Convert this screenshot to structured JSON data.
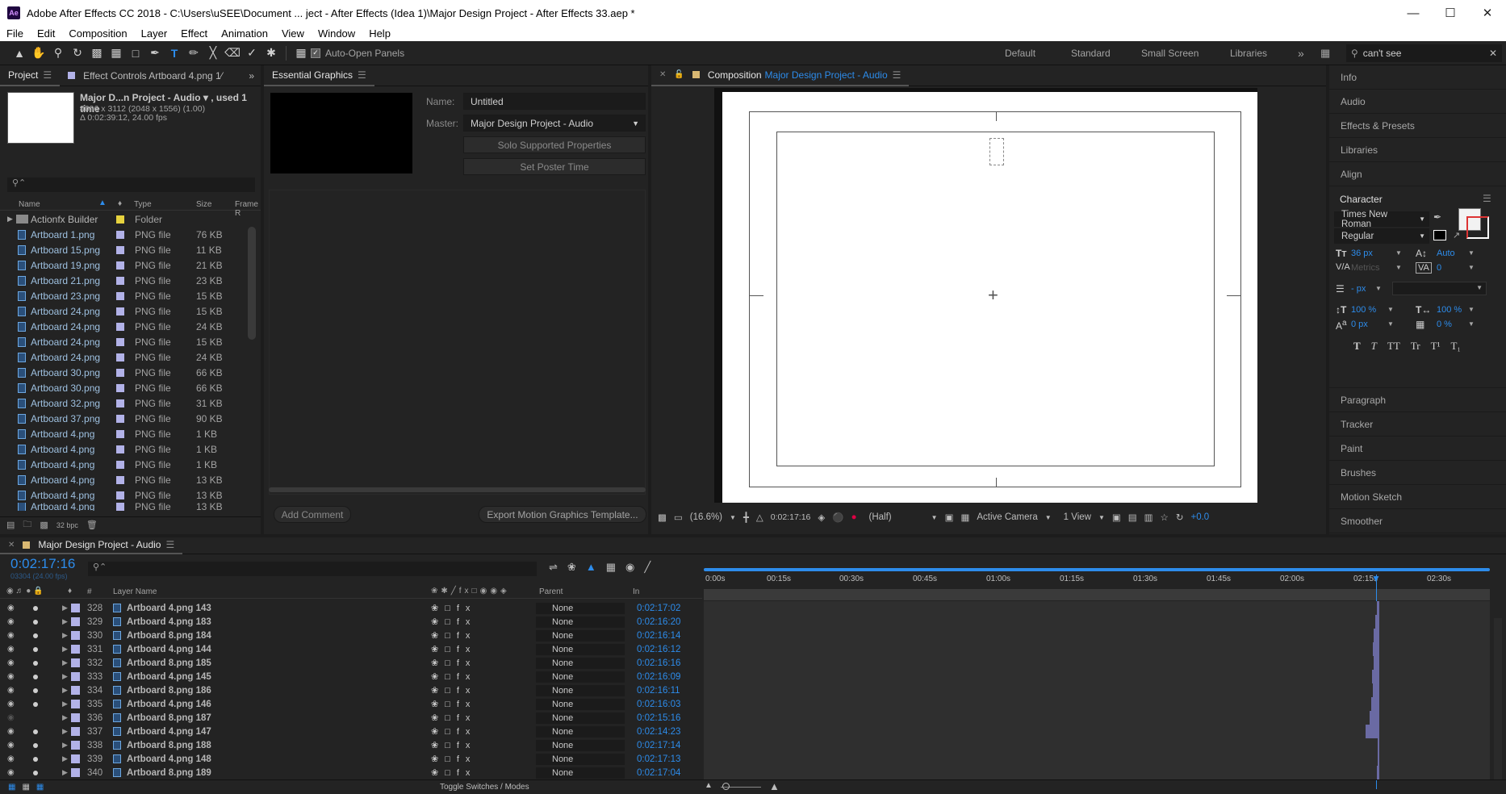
{
  "window": {
    "title": "Adobe After Effects CC 2018 - C:\\Users\\uSEE\\Document ... ject - After Effects (Idea 1)\\Major Design Project - After Effects 33.aep *",
    "app_icon": "Ae"
  },
  "menu": [
    "File",
    "Edit",
    "Composition",
    "Layer",
    "Effect",
    "Animation",
    "View",
    "Window",
    "Help"
  ],
  "toolbar": {
    "auto_open": "Auto-Open Panels",
    "workspaces": [
      "Default",
      "Standard",
      "Small Screen",
      "Libraries"
    ],
    "search": "can't see"
  },
  "project": {
    "tab1": "Project",
    "tab2": "Effect Controls Artboard 4.png 1⁄",
    "comp_name": "Major D...n Project - Audio ▾ , used 1 time",
    "comp_info1": "4096 x 3112  (2048 x 1556) (1.00)",
    "comp_info2": "Δ 0:02:39:12, 24.00 fps",
    "cols": [
      "Name",
      "Type",
      "Size",
      "Frame R"
    ],
    "items": [
      {
        "name": "Actionfx Builder",
        "type": "Folder",
        "size": ""
      },
      {
        "name": "Artboard 1.png",
        "type": "PNG file",
        "size": "76 KB"
      },
      {
        "name": "Artboard 15.png",
        "type": "PNG file",
        "size": "11 KB"
      },
      {
        "name": "Artboard 19.png",
        "type": "PNG file",
        "size": "21 KB"
      },
      {
        "name": "Artboard 21.png",
        "type": "PNG file",
        "size": "23 KB"
      },
      {
        "name": "Artboard 23.png",
        "type": "PNG file",
        "size": "15 KB"
      },
      {
        "name": "Artboard 24.png",
        "type": "PNG file",
        "size": "15 KB"
      },
      {
        "name": "Artboard 24.png",
        "type": "PNG file",
        "size": "24 KB"
      },
      {
        "name": "Artboard 24.png",
        "type": "PNG file",
        "size": "15 KB"
      },
      {
        "name": "Artboard 24.png",
        "type": "PNG file",
        "size": "24 KB"
      },
      {
        "name": "Artboard 30.png",
        "type": "PNG file",
        "size": "66 KB"
      },
      {
        "name": "Artboard 30.png",
        "type": "PNG file",
        "size": "66 KB"
      },
      {
        "name": "Artboard 32.png",
        "type": "PNG file",
        "size": "31 KB"
      },
      {
        "name": "Artboard 37.png",
        "type": "PNG file",
        "size": "90 KB"
      },
      {
        "name": "Artboard 4.png",
        "type": "PNG file",
        "size": "1 KB"
      },
      {
        "name": "Artboard 4.png",
        "type": "PNG file",
        "size": "1 KB"
      },
      {
        "name": "Artboard 4.png",
        "type": "PNG file",
        "size": "1 KB"
      },
      {
        "name": "Artboard 4.png",
        "type": "PNG file",
        "size": "13 KB"
      },
      {
        "name": "Artboard 4.png",
        "type": "PNG file",
        "size": "13 KB"
      },
      {
        "name": "Artboard 4.png",
        "type": "PNG file",
        "size": "13 KB"
      }
    ],
    "bpc": "32 bpc"
  },
  "eg": {
    "tab": "Essential Graphics",
    "name_label": "Name:",
    "name_value": "Untitled",
    "master_label": "Master:",
    "master_value": "Major Design Project - Audio",
    "solo": "Solo Supported Properties",
    "poster": "Set Poster Time",
    "add_comment": "Add Comment",
    "export": "Export Motion Graphics Template..."
  },
  "comp": {
    "tab_prefix": "Composition",
    "tab_name": "Major Design Project - Audio",
    "zoom": "(16.6%)",
    "time": "0:02:17:16",
    "res": "(Half)",
    "camera": "Active Camera",
    "view": "1 View",
    "exposure": "+0.0"
  },
  "right": {
    "items_top": [
      "Info",
      "Audio",
      "Effects & Presets",
      "Libraries",
      "Align"
    ],
    "character": "Character",
    "font": "Times New Roman",
    "style": "Regular",
    "size": "36 px",
    "leading": "Auto",
    "kerning": "Metrics",
    "tracking": "0",
    "stroke": "- px",
    "vscale": "100 %",
    "hscale": "100 %",
    "baseline": "0 px",
    "tsume": "0 %",
    "styles": [
      "T",
      "T",
      "TT",
      "Tr",
      "T¹",
      "T₁"
    ],
    "items_bottom": [
      "Paragraph",
      "Tracker",
      "Paint",
      "Brushes",
      "Motion Sketch",
      "Smoother"
    ]
  },
  "timeline": {
    "tab": "Major Design Project - Audio",
    "time": "0:02:17:16",
    "frames": "03304 (24.00 fps)",
    "cols": {
      "num": "#",
      "layer": "Layer Name",
      "parent": "Parent",
      "in": "In"
    },
    "ruler": [
      "0:00s",
      "00:15s",
      "00:30s",
      "00:45s",
      "01:00s",
      "01:15s",
      "01:30s",
      "01:45s",
      "02:00s",
      "02:15s",
      "02:30s"
    ],
    "rows": [
      {
        "num": "328",
        "name": "Artboard 4.png 143",
        "parent": "None",
        "in": "0:02:17:02"
      },
      {
        "num": "329",
        "name": "Artboard 4.png 183",
        "parent": "None",
        "in": "0:02:16:20"
      },
      {
        "num": "330",
        "name": "Artboard 8.png 184",
        "parent": "None",
        "in": "0:02:16:14"
      },
      {
        "num": "331",
        "name": "Artboard 4.png 144",
        "parent": "None",
        "in": "0:02:16:12"
      },
      {
        "num": "332",
        "name": "Artboard 8.png 185",
        "parent": "None",
        "in": "0:02:16:16"
      },
      {
        "num": "333",
        "name": "Artboard 4.png 145",
        "parent": "None",
        "in": "0:02:16:09"
      },
      {
        "num": "334",
        "name": "Artboard 8.png 186",
        "parent": "None",
        "in": "0:02:16:11"
      },
      {
        "num": "335",
        "name": "Artboard 4.png 146",
        "parent": "None",
        "in": "0:02:16:03"
      },
      {
        "num": "336",
        "name": "Artboard 8.png 187",
        "parent": "None",
        "in": "0:02:15:16"
      },
      {
        "num": "337",
        "name": "Artboard 4.png 147",
        "parent": "None",
        "in": "0:02:14:23"
      },
      {
        "num": "338",
        "name": "Artboard 8.png 188",
        "parent": "None",
        "in": "0:02:17:14"
      },
      {
        "num": "339",
        "name": "Artboard 4.png 148",
        "parent": "None",
        "in": "0:02:17:13"
      },
      {
        "num": "340",
        "name": "Artboard 8.png 189",
        "parent": "None",
        "in": "0:02:17:04"
      }
    ],
    "toggle": "Toggle Switches / Modes"
  }
}
